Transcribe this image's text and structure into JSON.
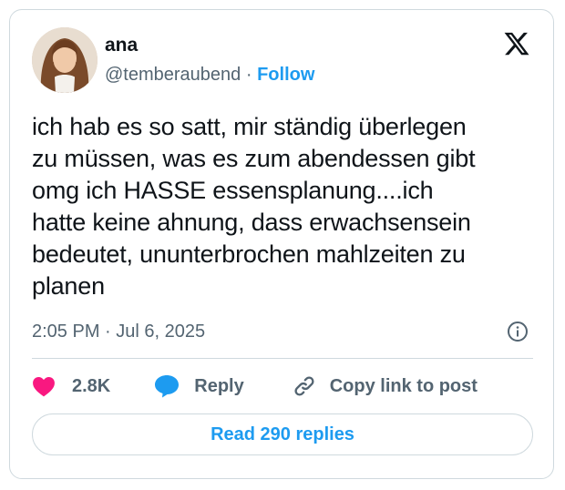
{
  "tweet": {
    "author_name": "ana",
    "handle": "@temberaubend",
    "separator": "·",
    "follow_label": "Follow",
    "text": "ich hab es so satt, mir ständig überlegen\nzu müssen, was es zum abendessen gibt\nomg ich HASSE essensplanung....ich\nhatte keine ahnung, dass erwachsensein\nbedeutet, ununterbrochen mahlzeiten zu\nplanen",
    "time": "2:05 PM",
    "date": "Jul 6, 2025",
    "likes_count": "2.8K",
    "reply_label": "Reply",
    "copy_link_label": "Copy link to post",
    "read_replies_label": "Read 290 replies"
  },
  "icons": {
    "brand": "x-logo-icon",
    "like": "heart-icon",
    "reply": "speech-bubble-icon",
    "copy": "link-icon",
    "info": "info-icon"
  },
  "colors": {
    "link_blue": "#1d9bf0",
    "heart_pink": "#f91880",
    "secondary_text": "#536471",
    "border": "#cfd9de"
  }
}
